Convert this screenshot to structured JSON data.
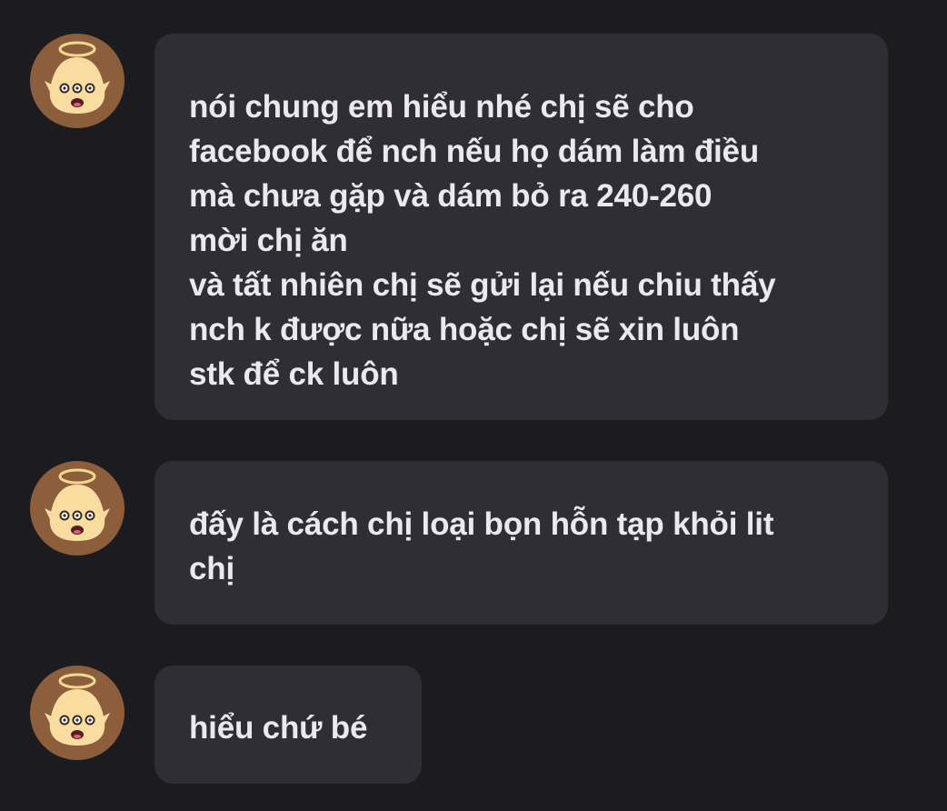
{
  "colors": {
    "background": "#1c1b20",
    "bubble": "#302e35",
    "text": "#ebe9ee",
    "avatar_bg": "#8c5e3c",
    "avatar_face": "#f8dca0",
    "halo": "#f3d98f"
  },
  "avatar": {
    "icon": "crying-angel-face-icon"
  },
  "messages": [
    {
      "lines": [
        "nói chung em hiểu nhé chị sẽ cho",
        "facebook để nch nếu họ dám làm điều",
        "mà chưa gặp và dám bỏ ra 240-260",
        "mời chị ăn",
        "và tất nhiên chị sẽ gửi lại nếu chiu thấy",
        "nch k được nữa hoặc chị sẽ xin luôn",
        "stk để ck luôn"
      ]
    },
    {
      "lines": [
        "đấy là cách chị loại bọn hỗn tạp khỏi lit",
        "chị"
      ]
    },
    {
      "lines": [
        "hiểu chứ bé"
      ]
    }
  ]
}
